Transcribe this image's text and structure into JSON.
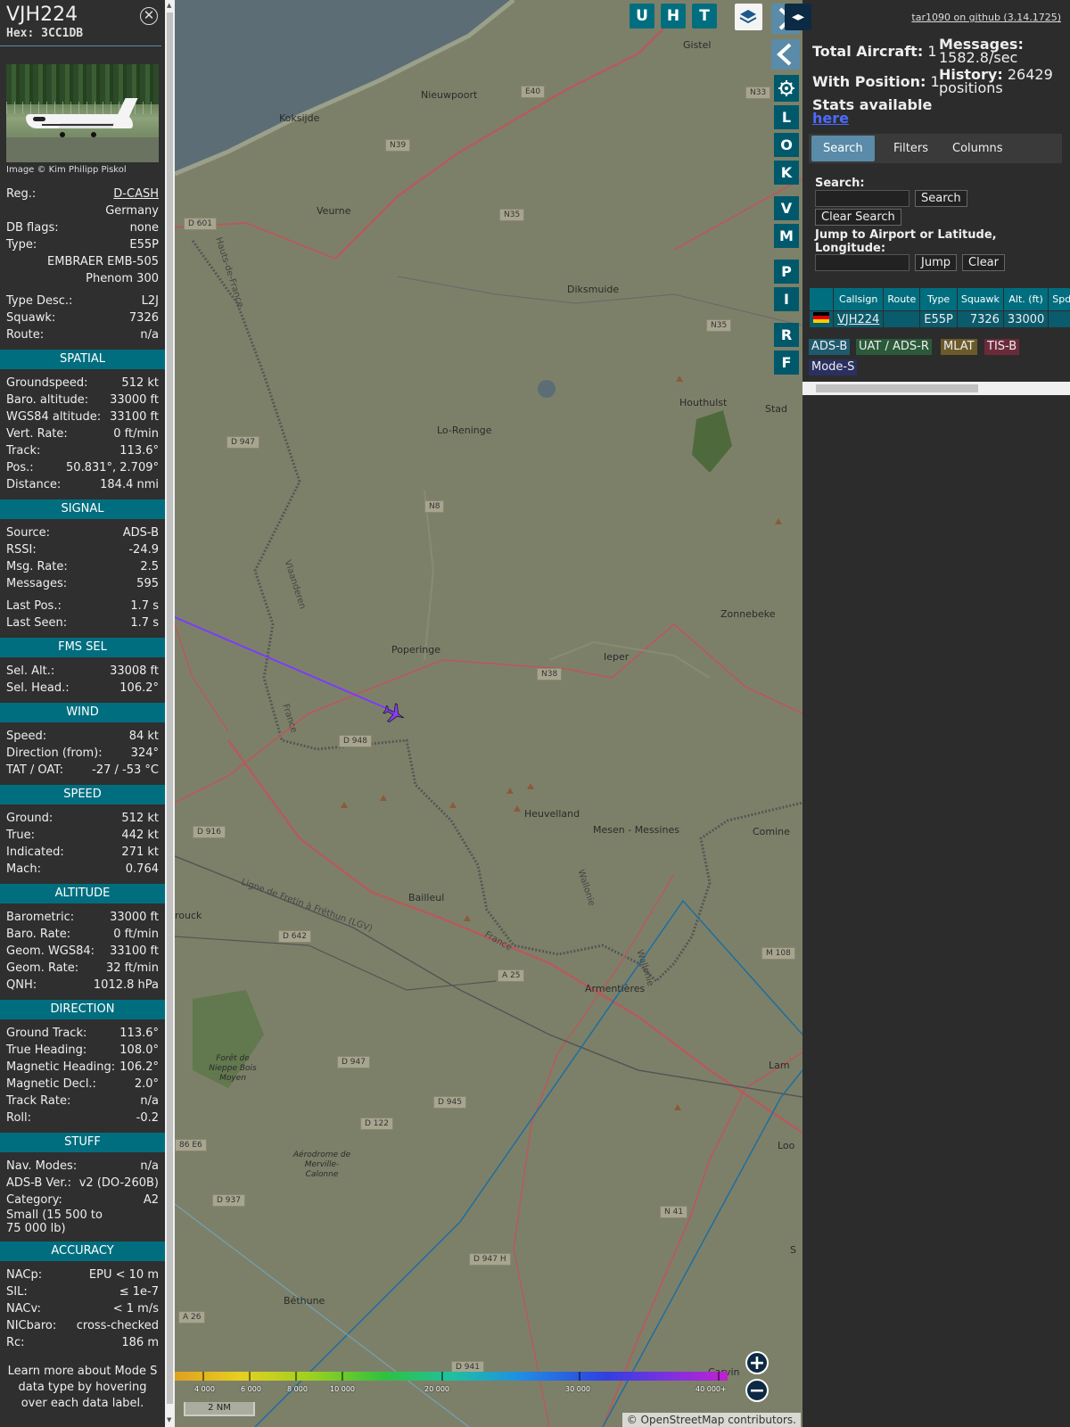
{
  "aircraft": {
    "callsign": "VJH224",
    "hex": "Hex: 3CC1DB",
    "image_credit": "Image © Kim Philipp Piskol",
    "details": [
      {
        "label": "Reg.:",
        "value": "D-CASH",
        "link": true
      },
      {
        "label": "",
        "value": "Germany"
      },
      {
        "label": "DB flags:",
        "value": "none"
      },
      {
        "label": "Type:",
        "value": "E55P"
      },
      {
        "label": "",
        "value": "EMBRAER EMB-505"
      },
      {
        "label": "",
        "value": "Phenom 300"
      },
      {
        "label": "Type Desc.:",
        "value": "L2J"
      },
      {
        "label": "Squawk:",
        "value": "7326"
      },
      {
        "label": "Route:",
        "value": "n/a"
      }
    ]
  },
  "sections": [
    {
      "title": "SPATIAL",
      "rows": [
        {
          "label": "Groundspeed:",
          "value": "512 kt"
        },
        {
          "label": "Baro. altitude:",
          "value": "33000 ft"
        },
        {
          "label": "WGS84 altitude:",
          "value": "33100 ft"
        },
        {
          "label": "Vert. Rate:",
          "value": "0 ft/min"
        },
        {
          "label": "Track:",
          "value": "113.6°"
        },
        {
          "label": "Pos.:",
          "value": "50.831°, 2.709°"
        },
        {
          "label": "Distance:",
          "value": "184.4 nmi"
        }
      ]
    },
    {
      "title": "SIGNAL",
      "rows": [
        {
          "label": "Source:",
          "value": "ADS-B"
        },
        {
          "label": "RSSI:",
          "value": "-24.9"
        },
        {
          "label": "Msg. Rate:",
          "value": "2.5"
        },
        {
          "label": "Messages:",
          "value": "595"
        },
        {
          "label": "Last Pos.:",
          "value": "1.7 s",
          "gap": true
        },
        {
          "label": "Last Seen:",
          "value": "1.7 s"
        }
      ]
    },
    {
      "title": "FMS SEL",
      "rows": [
        {
          "label": "Sel. Alt.:",
          "value": "33008 ft"
        },
        {
          "label": "Sel. Head.:",
          "value": "106.2°"
        }
      ]
    },
    {
      "title": "WIND",
      "rows": [
        {
          "label": "Speed:",
          "value": "84 kt"
        },
        {
          "label": "Direction (from):",
          "value": "324°"
        },
        {
          "label": "TAT / OAT:",
          "value": "-27 / -53 °C"
        }
      ]
    },
    {
      "title": "SPEED",
      "rows": [
        {
          "label": "Ground:",
          "value": "512 kt"
        },
        {
          "label": "True:",
          "value": "442 kt"
        },
        {
          "label": "Indicated:",
          "value": "271 kt"
        },
        {
          "label": "Mach:",
          "value": "0.764"
        }
      ]
    },
    {
      "title": "ALTITUDE",
      "rows": [
        {
          "label": "Barometric:",
          "value": "33000 ft"
        },
        {
          "label": "Baro. Rate:",
          "value": "0 ft/min"
        },
        {
          "label": "Geom. WGS84:",
          "value": "33100 ft"
        },
        {
          "label": "Geom. Rate:",
          "value": "32 ft/min"
        },
        {
          "label": "QNH:",
          "value": "1012.8 hPa"
        }
      ]
    },
    {
      "title": "DIRECTION",
      "rows": [
        {
          "label": "Ground Track:",
          "value": "113.6°"
        },
        {
          "label": "True Heading:",
          "value": "108.0°"
        },
        {
          "label": "Magnetic Heading:",
          "value": "106.2°"
        },
        {
          "label": "Magnetic Decl.:",
          "value": "2.0°"
        },
        {
          "label": "Track Rate:",
          "value": "n/a"
        },
        {
          "label": "Roll:",
          "value": "-0.2"
        }
      ]
    },
    {
      "title": "STUFF",
      "rows": [
        {
          "label": "Nav. Modes:",
          "value": "n/a"
        },
        {
          "label": "ADS-B Ver.:",
          "value": "v2 (DO-260B)"
        },
        {
          "label": "Category:",
          "value": "A2"
        },
        {
          "label": "Small (15 500 to 75 000 lb)",
          "value": "",
          "wrap": true
        }
      ]
    },
    {
      "title": "ACCURACY",
      "rows": [
        {
          "label": "NACp:",
          "value": "EPU < 10 m"
        },
        {
          "label": "SIL:",
          "value": "≤ 1e-7"
        },
        {
          "label": "NACv:",
          "value": "< 1 m/s"
        },
        {
          "label": "NICbaro:",
          "value": "cross-checked"
        },
        {
          "label": "Rc:",
          "value": "186 m"
        }
      ]
    }
  ],
  "mode_s_note": "Learn more about Mode S data type by hovering over each data label.",
  "map": {
    "top_buttons": [
      "U",
      "H",
      "T"
    ],
    "side_buttons": [
      "L",
      "O",
      "K",
      "V",
      "M",
      "P",
      "I",
      "R",
      "F"
    ],
    "towns": [
      {
        "name": "Gistel"
      },
      {
        "name": "Nieuwpoort"
      },
      {
        "name": "Koksijde"
      },
      {
        "name": "Veurne"
      },
      {
        "name": "Diksmuide"
      },
      {
        "name": "Houthulst"
      },
      {
        "name": "Stad"
      },
      {
        "name": "Lo-Reninge"
      },
      {
        "name": "Zonnebeke"
      },
      {
        "name": "Poperinge"
      },
      {
        "name": "Ieper"
      },
      {
        "name": "Heuvelland"
      },
      {
        "name": "Mesen - Messines"
      },
      {
        "name": "Comine"
      },
      {
        "name": "Bailleul"
      },
      {
        "name": "rouck"
      },
      {
        "name": "Armentières"
      },
      {
        "name": "Forêt de Nieppe Bois Moyen"
      },
      {
        "name": "Aérodrome de Merville-Calonne"
      },
      {
        "name": "Béthune"
      },
      {
        "name": "Carvin"
      },
      {
        "name": "Lam"
      },
      {
        "name": "Loo"
      },
      {
        "name": "S"
      }
    ],
    "roads": [
      "N33",
      "N39",
      "N35",
      "D 601",
      "E40",
      "D 947",
      "N8",
      "N38",
      "D 948",
      "D 916",
      "D 642",
      "A 25",
      "M 108",
      "D 947",
      "D 945",
      "D 122",
      "86 E6",
      "D 937",
      "N 41",
      "D 947 H",
      "A 26",
      "D 941",
      "N35"
    ],
    "labels": [
      "Hauts-de-France",
      "Vlaanderen",
      "France",
      "Ligne de Fretin à Fréthun (LGV)",
      "France",
      "Wallonie",
      "Wallonie"
    ],
    "altitude_ticks": [
      "4 000",
      "6 000",
      "8 000",
      "10 000",
      "20 000",
      "30 000",
      "40 000+"
    ],
    "scale": "2 NM",
    "attribution": "© OpenStreetMap contributors."
  },
  "side": {
    "github_link": "tar1090 on github (3.14.1725)",
    "total_aircraft_label": "Total Aircraft:",
    "total_aircraft": "1",
    "with_position_label": "With Position:",
    "with_position": "1",
    "stats_label": "Stats available",
    "stats_link": "here",
    "messages_label": "Messages:",
    "messages": "1582.8/sec",
    "history_label": "History:",
    "history": "26429",
    "history_unit": "positions",
    "tabs": [
      "Search",
      "Filters",
      "Columns"
    ],
    "search_label": "Search:",
    "search_button": "Search",
    "clear_search_button": "Clear Search",
    "jump_label": "Jump to Airport or Latitude, Longitude:",
    "jump_button": "Jump",
    "clear_button": "Clear",
    "columns": [
      "",
      "Callsign",
      "Route",
      "Type",
      "Squawk",
      "Alt. (ft)",
      "Spd."
    ],
    "rows": [
      {
        "callsign": "VJH224",
        "route": "",
        "type": "E55P",
        "squawk": "7326",
        "alt": "33000",
        "spd": ""
      }
    ],
    "legend": [
      {
        "label": "ADS-B",
        "color": "#1e5a6e"
      },
      {
        "label": "UAT / ADS-R",
        "color": "#2a5a3a"
      },
      {
        "label": "MLAT",
        "color": "#6b5a2a"
      },
      {
        "label": "TIS-B",
        "color": "#6b2a3a"
      },
      {
        "label": "Mode-S",
        "color": "#2a3060"
      }
    ]
  },
  "colors": {
    "accent": "#006e7f",
    "track": "#7b3cff",
    "aircraft": "#8b3cff"
  }
}
